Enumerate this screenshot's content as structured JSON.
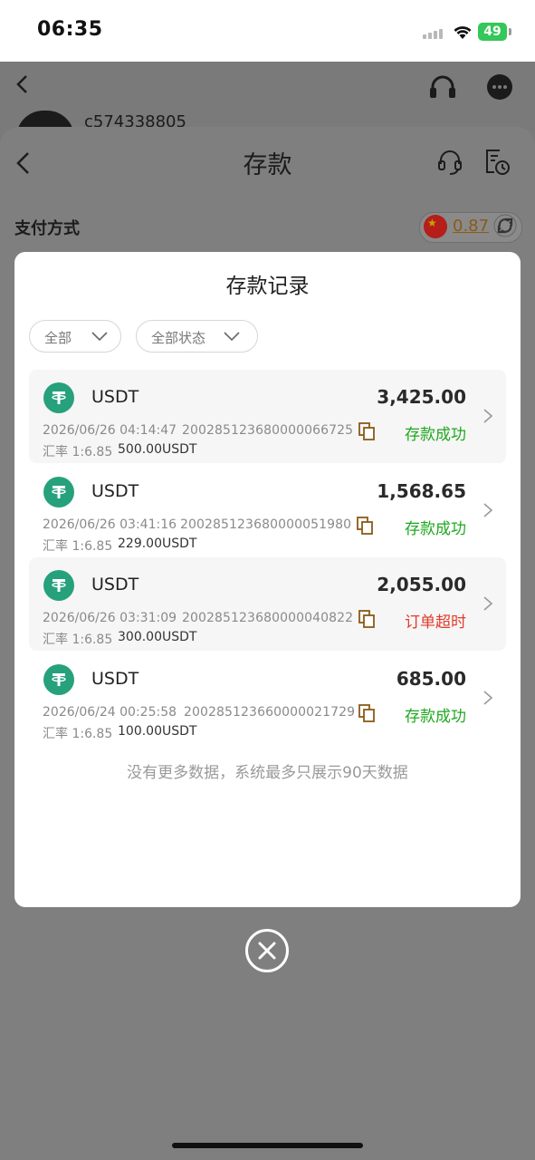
{
  "status_bar": {
    "time": "06:35",
    "battery": "49"
  },
  "background": {
    "username": "c574338805"
  },
  "sheet": {
    "title": "存款",
    "payment_label": "支付方式",
    "rate_value": "0.87"
  },
  "modal": {
    "title": "存款记录",
    "filters": [
      {
        "label": "全部"
      },
      {
        "label": "全部状态"
      }
    ],
    "records": [
      {
        "coin": "USDT",
        "amount": "3,425.00",
        "date": "2026/06/26 04:14:47",
        "order_id": "200285123680000066725",
        "status": "存款成功",
        "rate": "汇率 1:6.85",
        "usdt": "500.00USDT"
      },
      {
        "coin": "USDT",
        "amount": "1,568.65",
        "date": "2026/06/26 03:41:16",
        "order_id": "200285123680000051980",
        "status": "存款成功",
        "rate": "汇率 1:6.85",
        "usdt": "229.00USDT"
      },
      {
        "coin": "USDT",
        "amount": "2,055.00",
        "date": "2026/06/26 03:31:09",
        "order_id": "200285123680000040822",
        "status": "订单超时",
        "rate": "汇率 1:6.85",
        "usdt": "300.00USDT"
      },
      {
        "coin": "USDT",
        "amount": "685.00",
        "date": "2026/06/24 00:25:58",
        "order_id": "200285123660000021729",
        "status": "存款成功",
        "rate": "汇率 1:6.85",
        "usdt": "100.00USDT"
      }
    ],
    "no_more_text": "没有更多数据，系统最多只展示90天数据"
  },
  "colors": {
    "success": "#1fa81f",
    "fail": "#e23b2c",
    "usdt": "#26a17b",
    "rate_text": "#8a5a17"
  }
}
